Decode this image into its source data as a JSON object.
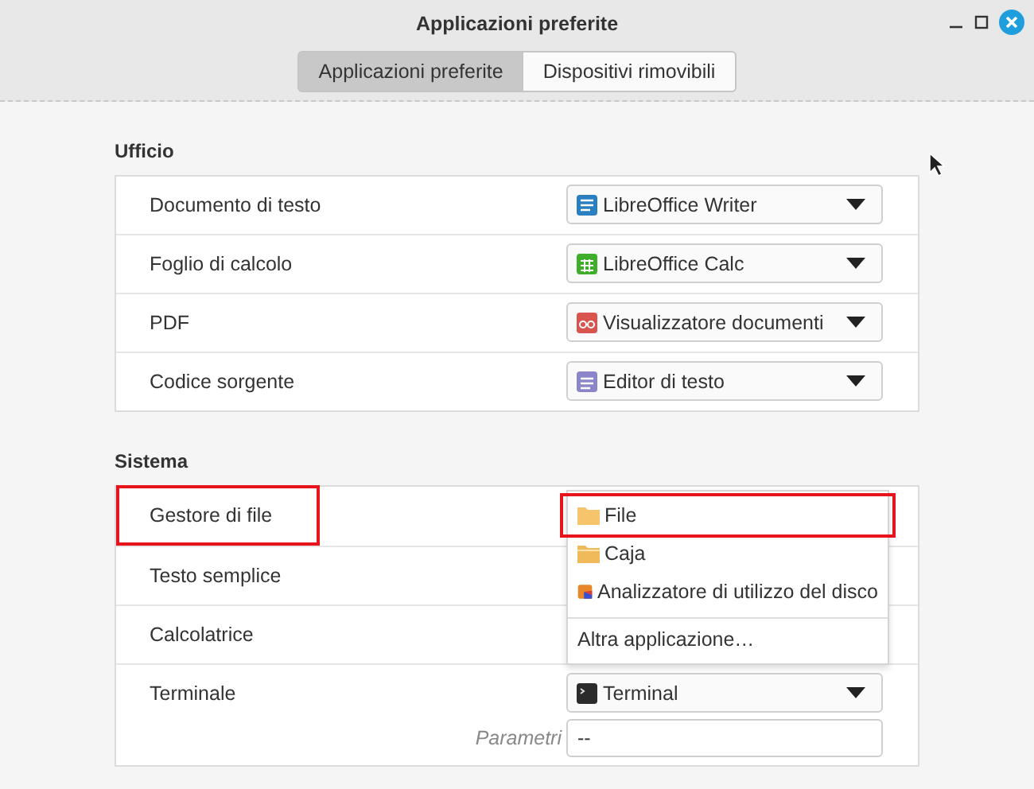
{
  "window": {
    "title": "Applicazioni preferite"
  },
  "tabs": [
    {
      "label": "Applicazioni preferite",
      "selected": true
    },
    {
      "label": "Dispositivi rimovibili",
      "selected": false
    }
  ],
  "sections": [
    {
      "title": "Ufficio",
      "rows": [
        {
          "label": "Documento di testo",
          "value": "LibreOffice Writer",
          "highlighted": false
        },
        {
          "label": "Foglio di calcolo",
          "value": "LibreOffice Calc",
          "highlighted": false
        },
        {
          "label": "PDF",
          "value": "Visualizzatore documenti",
          "highlighted": false
        },
        {
          "label": "Codice sorgente",
          "value": "Editor di testo",
          "highlighted": false
        }
      ]
    },
    {
      "title": "Sistema",
      "rows": [
        {
          "label": "Gestore di file",
          "highlighted": true
        },
        {
          "label": "Testo semplice",
          "highlighted": false
        },
        {
          "label": "Calcolatrice",
          "highlighted": false
        },
        {
          "label": "Terminale",
          "value": "Terminal",
          "highlighted": false,
          "parameters": {
            "label": "Parametri",
            "value": "--"
          }
        }
      ]
    }
  ],
  "popup": {
    "items": [
      {
        "label": "File",
        "highlighted": true
      },
      {
        "label": "Caja",
        "highlighted": false
      },
      {
        "label": "Analizzatore di utilizzo del disco",
        "highlighted": false
      }
    ],
    "footer": "Altra applicazione…"
  }
}
